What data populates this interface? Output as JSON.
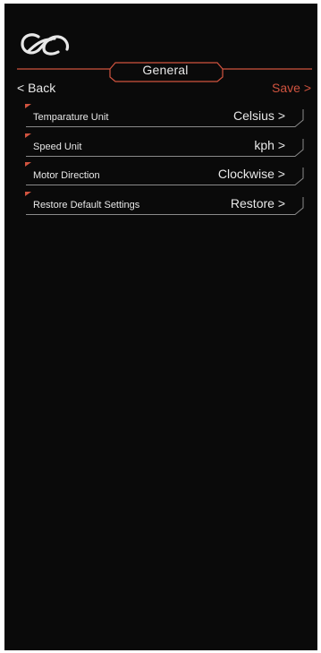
{
  "header": {
    "title": "General",
    "back_label": "< Back",
    "save_label": "Save >"
  },
  "colors": {
    "background": "#0a0a0a",
    "text": "#e8e8e8",
    "accent": "#d0533f",
    "divider": "#8a8a8a"
  },
  "settings": {
    "items": [
      {
        "label": "Temparature Unit",
        "value": "Celsius  >"
      },
      {
        "label": "Speed Unit",
        "value": "kph  >"
      },
      {
        "label": "Motor Direction",
        "value": "Clockwise  >"
      },
      {
        "label": "Restore Default Settings",
        "value": "Restore  >"
      }
    ]
  }
}
